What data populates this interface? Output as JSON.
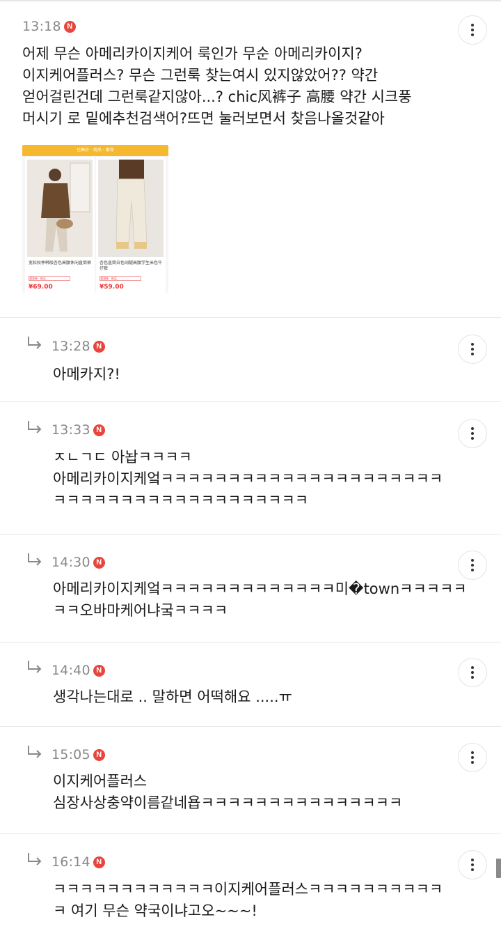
{
  "comments": [
    {
      "time": "13:18",
      "badge": "N",
      "text": "어제 무슨 아메리카이지케어 룩인가 무순 아메리카이지?\n이지케어플러스? 무슨 그런룩 찾는여시 있지않았어?? 약간\n얻어걸린건데 그런룩같지않아...? chic风裤子 高腰 약간 시크풍\n머시기 로 밑에추천검색어?뜨면 눌러보면서 찾음나올것같아",
      "thumbnail": {
        "banner": "已售价 · 商品 · 推荐",
        "products": [
          {
            "caption": "宽松秋季韩版杏色高腰休闲直筒裤",
            "tag": "满减券 · 新品",
            "price": "¥69.00"
          },
          {
            "caption": "杏色直筒白色阔腿高腰学生米色牛仔裤",
            "tag": "满减券 · 新品",
            "price": "¥59.00"
          }
        ]
      }
    },
    {
      "time": "13:28",
      "badge": "N",
      "text": "아메카지?!"
    },
    {
      "time": "13:33",
      "badge": "N",
      "text": "ㅈㄴㄱㄷ 아놥ㅋㅋㅋㅋ\n아메리카이지케엌ㅋㅋㅋㅋㅋㅋㅋㅋㅋㅋㅋㅋㅋㅋㅋㅋㅋㅋㅋㅋㅋ\nㅋㅋㅋㅋㅋㅋㅋㅋㅋㅋㅋㅋㅋㅋㅋㅋㅋㅋㅋ"
    },
    {
      "time": "14:30",
      "badge": "N",
      "text": "아메리카이지케엌ㅋㅋㅋㅋㅋㅋㅋㅋㅋㅋㅋㅋㅋ미�townㅋㅋㅋㅋㅋ\nㅋㅋ오바마케어냐궄ㅋㅋㅋㅋ"
    },
    {
      "time": "14:40",
      "badge": "N",
      "text": "생각나는대로 .. 말하면 어떡해요 .....ㅠ"
    },
    {
      "time": "15:05",
      "badge": "N",
      "text": "이지케어플러스\n심장사상충약이름같네욥ㅋㅋㅋㅋㅋㅋㅋㅋㅋㅋㅋㅋㅋㅋㅋ"
    },
    {
      "time": "16:14",
      "badge": "N",
      "text": "ㅋㅋㅋㅋㅋㅋㅋㅋㅋㅋㅋㅋ이지케어플러스ㅋㅋㅋㅋㅋㅋㅋㅋㅋㅋ\nㅋ 여기 무슨 약국이냐고오~~~!"
    }
  ],
  "icons": {
    "more": "more-vertical-icon",
    "reply": "reply-arrow-icon"
  },
  "colors": {
    "badge": "#e8453c",
    "time": "#888888",
    "divider": "#e9e9e9"
  }
}
